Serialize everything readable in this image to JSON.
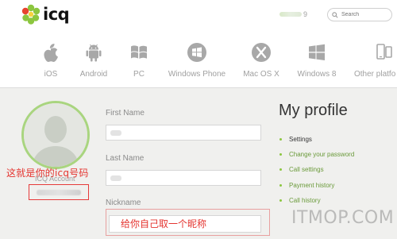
{
  "header": {
    "logo_text": "icq",
    "user_fragment": "9",
    "search": {
      "placeholder": "Search"
    }
  },
  "platforms": [
    {
      "label": "iOS",
      "icon": "apple-icon"
    },
    {
      "label": "Android",
      "icon": "android-icon"
    },
    {
      "label": "PC",
      "icon": "windows-flag-icon"
    },
    {
      "label": "Windows Phone",
      "icon": "windows-phone-icon"
    },
    {
      "label": "Mac OS X",
      "icon": "mac-x-icon"
    },
    {
      "label": "Windows 8",
      "icon": "windows8-icon"
    },
    {
      "label": "Other platfo",
      "icon": "devices-icon"
    }
  ],
  "profile": {
    "title": "My profile",
    "icq_account_label": "ICQ Account",
    "fields": {
      "first_name_label": "First Name",
      "last_name_label": "Last Name",
      "nickname_label": "Nickname"
    },
    "menu": [
      {
        "label": "Settings",
        "active": true
      },
      {
        "label": "Change your password",
        "active": false
      },
      {
        "label": "Call settings",
        "active": false
      },
      {
        "label": "Payment history",
        "active": false
      },
      {
        "label": "Call history",
        "active": false
      }
    ]
  },
  "annotations": {
    "icq_number_note": "这就是你的icq号码",
    "nickname_note": "给你自己取一个昵称"
  },
  "watermark": "ITMOP.COM",
  "colors": {
    "accent_green": "#8cc63f",
    "avatar_ring": "#a9d57f",
    "annotation_red": "#e4342f",
    "content_bg": "#f0f0ee"
  }
}
